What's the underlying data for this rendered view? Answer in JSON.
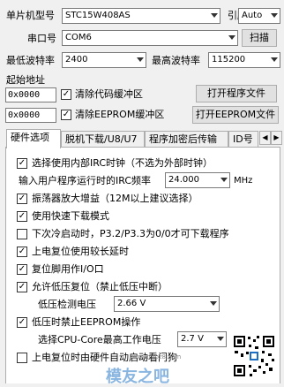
{
  "top": {
    "mcu_label": "单片机型号",
    "mcu_value": "STC15W408AS",
    "pins_label": "引脚数",
    "pins_value": "Auto",
    "port_label": "串口号",
    "port_value": "COM6",
    "scan_button": "扫描",
    "min_baud_label": "最低波特率",
    "min_baud_value": "2400",
    "max_baud_label": "最高波特率",
    "max_baud_value": "115200",
    "start_addr_label": "起始地址",
    "addr1_value": "0x0000",
    "clear_code_label": "清除代码缓冲区",
    "open_program_button": "打开程序文件",
    "addr2_value": "0x0000",
    "clear_eeprom_label": "清除EEPROM缓冲区",
    "open_eeprom_button": "打开EEPROM文件"
  },
  "tabs": [
    {
      "label": "硬件选项"
    },
    {
      "label": "脱机下载/U8/U7"
    },
    {
      "label": "程序加密后传输"
    },
    {
      "label": "ID号"
    }
  ],
  "options": {
    "internal_irc": "选择使用内部IRC时钟（不选为外部时钟）",
    "irc_freq_label": "输入用户程序运行时的IRC频率",
    "irc_freq_value": "24.000",
    "irc_freq_unit": "MHz",
    "osc_gain": "振荡器放大增益（12M以上建议选择）",
    "fast_download": "使用快速下载模式",
    "p32_p33": "下次冷启动时，P3.2/P3.3为0/0才可下载程序",
    "long_delay": "上电复位使用较长延时",
    "reset_pin_io": "复位脚用作I/O口",
    "low_volt_reset": "允许低压复位（禁止低压中断）",
    "low_volt_label": "低压检测电压",
    "low_volt_value": "2.66 V",
    "low_volt_eeprom": "低压时禁止EEPROM操作",
    "cpu_core_label": "选择CPU-Core最高工作电压",
    "cpu_core_value": "2.7 V",
    "power_on_reset": "上电复位时由硬件自动启动看门狗"
  },
  "watermark": "模友之吧",
  "watermark_url": "www.moz8.com"
}
